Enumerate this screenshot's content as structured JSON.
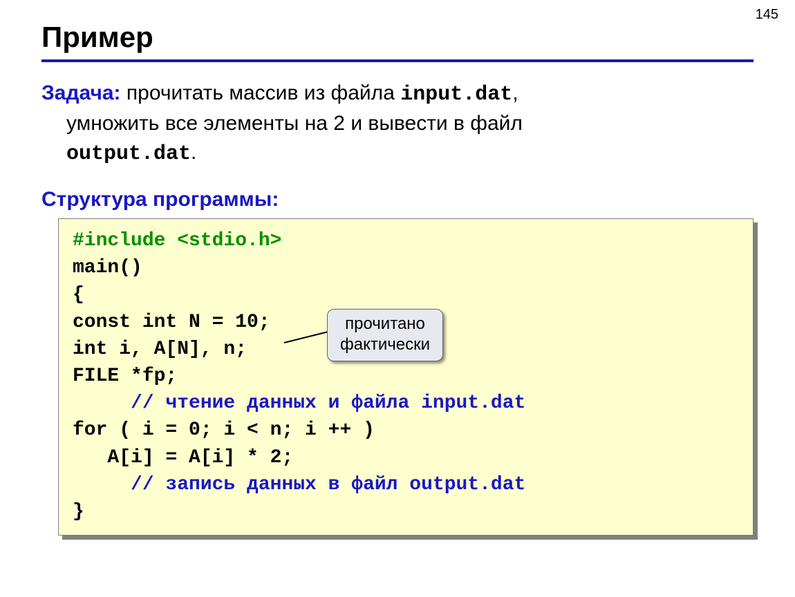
{
  "pageNumber": "145",
  "title": "Пример",
  "task": {
    "label": "Задача:",
    "line1_a": " прочитать массив из файла ",
    "line1_b": "input.dat",
    "line1_c": ",",
    "line2_a": "умножить все элементы на 2 и вывести в файл",
    "line3_a": "output.dat",
    "line3_b": "."
  },
  "structLabel": "Структура программы:",
  "code": {
    "l1": "#include <stdio.h>",
    "l2": "main()",
    "l3": "{",
    "l4": "const int N = 10;",
    "l5": "int i, A[N], n;",
    "l6": "FILE *fp;",
    "l7": "     // чтение данных и файла input.dat",
    "l8": "for ( i = 0; i < n; i ++ )",
    "l9": "   A[i] = A[i] * 2;",
    "l10": "     // запись данных в файл output.dat",
    "l11": "}"
  },
  "callout": {
    "line1": "прочитано",
    "line2": "фактически"
  }
}
